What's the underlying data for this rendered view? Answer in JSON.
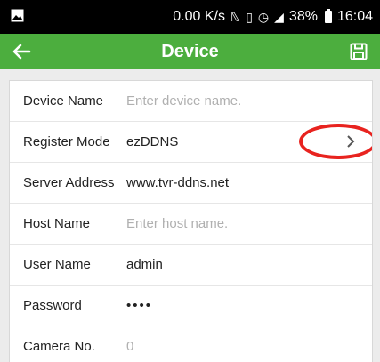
{
  "status_bar": {
    "net_speed": "0.00 K/s",
    "battery": "38%",
    "time": "16:04"
  },
  "header": {
    "title": "Device"
  },
  "fields": [
    {
      "label": "Device Name",
      "value": "",
      "placeholder": "Enter device name."
    },
    {
      "label": "Register Mode",
      "value": "ezDDNS"
    },
    {
      "label": "Server Address",
      "value": "www.tvr-ddns.net"
    },
    {
      "label": "Host Name",
      "value": "",
      "placeholder": "Enter host name."
    },
    {
      "label": "User Name",
      "value": "admin"
    },
    {
      "label": "Password",
      "value": "••••"
    },
    {
      "label": "Camera No.",
      "value": "0"
    }
  ],
  "colors": {
    "header": "#4cae3e",
    "highlight": "#e8231f"
  }
}
